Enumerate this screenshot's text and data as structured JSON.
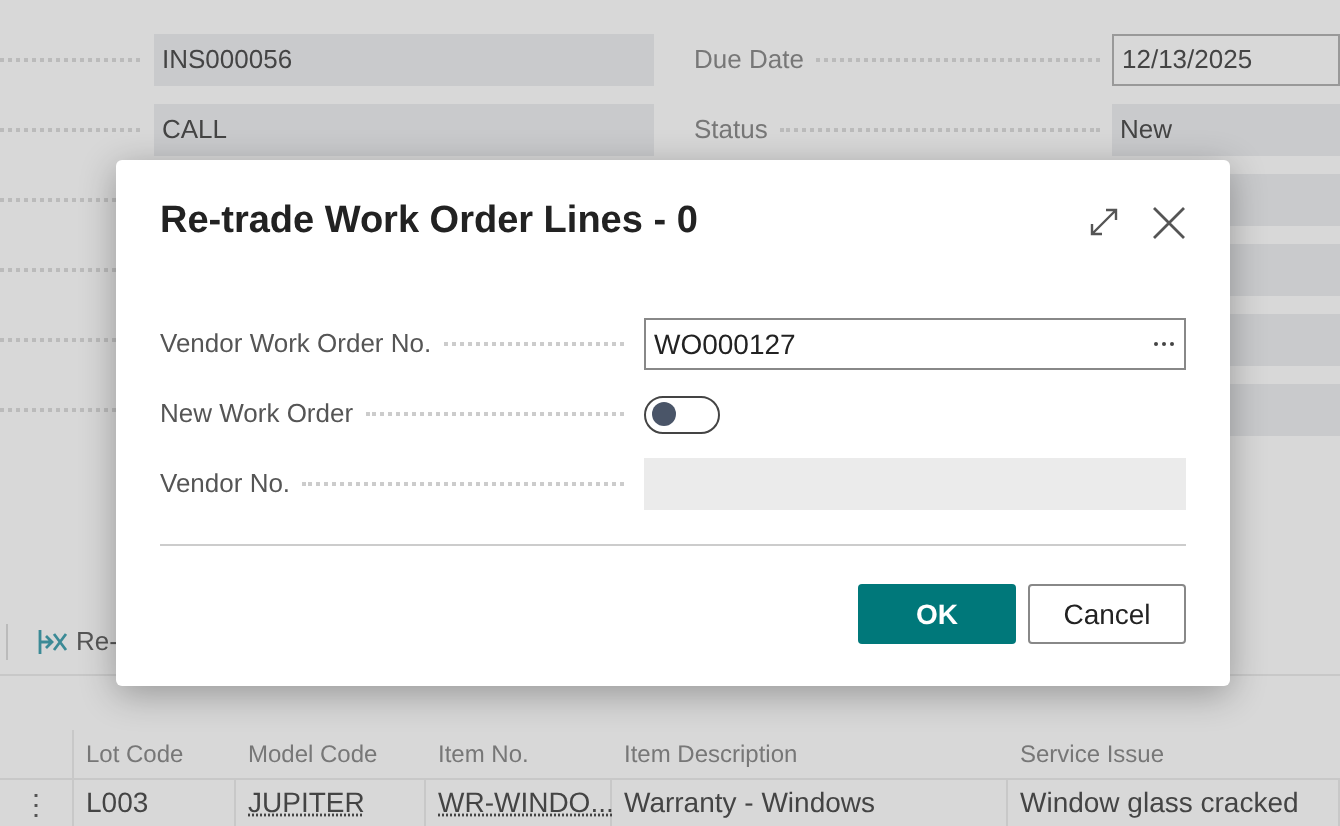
{
  "page": {
    "left_fields": [
      {
        "value": "INS000056"
      },
      {
        "value": "CALL"
      }
    ],
    "right_fields": [
      {
        "label": "Due Date",
        "value": "12/13/2025",
        "kind": "date"
      },
      {
        "label": "Status",
        "value": "New",
        "kind": "readonly"
      }
    ],
    "actions": [
      {
        "label": "Re-"
      }
    ],
    "table": {
      "columns": [
        "Lot Code",
        "Model Code",
        "Item No.",
        "Item Description",
        "Service Issue"
      ],
      "rows": [
        {
          "menu": "⋮",
          "cells": [
            "L003",
            "JUPITER",
            "WR-WINDO...",
            "Warranty - Windows",
            "Window glass cracked"
          ]
        }
      ]
    }
  },
  "dialog": {
    "title": "Re-trade Work Order Lines - 0",
    "fields": [
      {
        "label": "Vendor Work Order No.",
        "kind": "lookup",
        "value": "WO000127",
        "disabled": false
      },
      {
        "label": "New Work Order",
        "kind": "toggle",
        "on": false
      },
      {
        "label": "Vendor No.",
        "kind": "text",
        "disabled": true
      }
    ],
    "buttons": [
      {
        "label": "OK",
        "kind": "primary"
      },
      {
        "label": "Cancel",
        "kind": "secondary"
      }
    ]
  }
}
